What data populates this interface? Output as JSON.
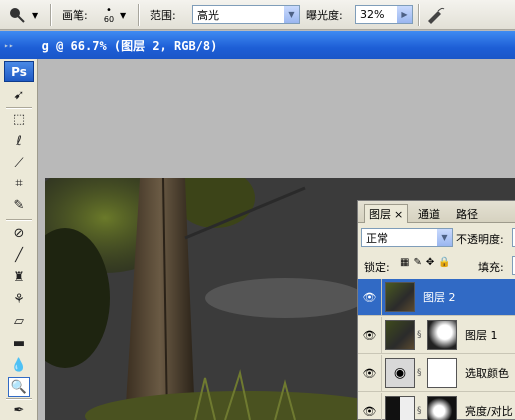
{
  "options_bar": {
    "tool_icon": "dodge-tool-icon",
    "brush_label": "画笔:",
    "brush_size": "60",
    "range_label": "范围:",
    "range_value": "高光",
    "exposure_label": "曝光度:",
    "exposure_value": "32%",
    "airbrush_icon": "airbrush-icon"
  },
  "document": {
    "title": "g @ 66.7% (图层 2, RGB/8)"
  },
  "toolbox": {
    "logo": "Ps",
    "tools": [
      "move-tool-icon",
      "marquee-tool-icon",
      "lasso-tool-icon",
      "magic-wand-icon",
      "crop-tool-icon",
      "slice-tool-icon",
      "healing-brush-icon",
      "brush-tool-icon",
      "clone-stamp-icon",
      "history-brush-icon",
      "eraser-icon",
      "gradient-tool-icon",
      "blur-tool-icon",
      "dodge-tool-icon",
      "pen-tool-icon"
    ]
  },
  "layers_panel": {
    "tabs": [
      "图层",
      "通道",
      "路径"
    ],
    "close_glyph": "×",
    "blend_mode": "正常",
    "opacity_label": "不透明度:",
    "lock_label": "锁定:",
    "fill_label": "填充:",
    "layers": [
      {
        "name": "图层 2",
        "selected": true
      },
      {
        "name": "图层 1",
        "selected": false
      },
      {
        "name": "选取颜色",
        "selected": false
      },
      {
        "name": "亮度/对比",
        "selected": false
      }
    ]
  },
  "colors": {
    "title_bar": "#1d5ed6",
    "selection": "#316ac5",
    "panel_bg": "#ece9d8"
  }
}
